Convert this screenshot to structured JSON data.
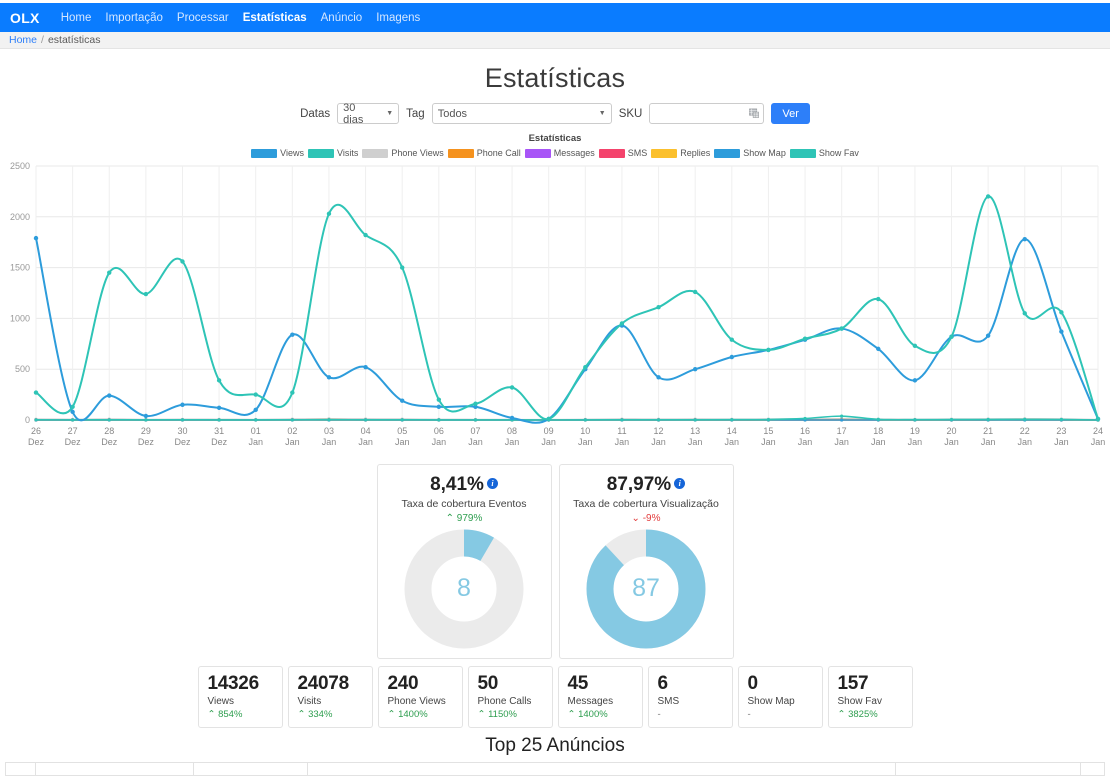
{
  "navbar": {
    "brand": "OLX",
    "items": [
      {
        "label": "Home",
        "active": false
      },
      {
        "label": "Importação",
        "active": false
      },
      {
        "label": "Processar",
        "active": false
      },
      {
        "label": "Estatísticas",
        "active": true
      },
      {
        "label": "Anúncio",
        "active": false
      },
      {
        "label": "Imagens",
        "active": false
      }
    ]
  },
  "breadcrumb": {
    "home": "Home",
    "separator": "/",
    "current": "estatísticas"
  },
  "page": {
    "title": "Estatísticas"
  },
  "filters": {
    "datas_label": "Datas",
    "datas_value": "30 dias",
    "tag_label": "Tag",
    "tag_value": "Todos",
    "sku_label": "SKU",
    "sku_value": "",
    "sku_placeholder": "",
    "submit_label": "Ver"
  },
  "chart_data": {
    "type": "line",
    "title": "Estatísticas",
    "xlabel": "",
    "ylabel": "",
    "ylim": [
      0,
      2500
    ],
    "yticks": [
      0,
      500,
      1000,
      1500,
      2000,
      2500
    ],
    "grid": true,
    "legend_position": "top",
    "x": [
      "26 Dez",
      "27 Dez",
      "28 Dez",
      "29 Dez",
      "30 Dez",
      "31 Dez",
      "01 Jan",
      "02 Jan",
      "03 Jan",
      "04 Jan",
      "05 Jan",
      "06 Jan",
      "07 Jan",
      "08 Jan",
      "09 Jan",
      "10 Jan",
      "11 Jan",
      "12 Jan",
      "13 Jan",
      "14 Jan",
      "15 Jan",
      "16 Jan",
      "17 Jan",
      "18 Jan",
      "19 Jan",
      "20 Jan",
      "21 Jan",
      "22 Jan",
      "23 Jan",
      "24 Jan"
    ],
    "series": [
      {
        "name": "Views",
        "color": "#2d9cdb",
        "values": [
          1790,
          80,
          240,
          40,
          150,
          120,
          100,
          840,
          420,
          520,
          190,
          130,
          130,
          20,
          10,
          500,
          930,
          420,
          500,
          620,
          690,
          790,
          900,
          700,
          390,
          820,
          830,
          1780,
          870,
          10
        ]
      },
      {
        "name": "Visits",
        "color": "#2ec4b6",
        "values": [
          270,
          130,
          1450,
          1240,
          1560,
          390,
          250,
          270,
          2030,
          1820,
          1500,
          200,
          160,
          320,
          10,
          520,
          950,
          1110,
          1260,
          790,
          690,
          800,
          900,
          1190,
          730,
          820,
          2200,
          1050,
          1060,
          10
        ]
      },
      {
        "name": "Phone Views",
        "color": "#cfcfcf",
        "values": [
          8,
          6,
          9,
          5,
          7,
          6,
          5,
          9,
          12,
          10,
          9,
          6,
          5,
          4,
          3,
          6,
          9,
          8,
          9,
          8,
          9,
          10,
          12,
          9,
          7,
          9,
          10,
          12,
          10,
          3
        ]
      },
      {
        "name": "Phone Call",
        "color": "#f5921e",
        "values": [
          2,
          1,
          2,
          1,
          2,
          1,
          1,
          2,
          3,
          2,
          2,
          1,
          1,
          1,
          0,
          1,
          2,
          2,
          2,
          2,
          2,
          2,
          3,
          2,
          2,
          2,
          2,
          3,
          2,
          0
        ]
      },
      {
        "name": "Messages",
        "color": "#a855f7",
        "values": [
          1,
          1,
          2,
          1,
          1,
          1,
          1,
          2,
          2,
          2,
          1,
          1,
          1,
          1,
          0,
          1,
          2,
          1,
          2,
          1,
          2,
          2,
          2,
          2,
          1,
          2,
          2,
          2,
          2,
          0
        ]
      },
      {
        "name": "SMS",
        "color": "#f4436c",
        "values": [
          0,
          0,
          1,
          0,
          0,
          0,
          0,
          1,
          1,
          0,
          0,
          0,
          0,
          0,
          0,
          0,
          1,
          0,
          1,
          0,
          0,
          1,
          1,
          0,
          0,
          0,
          1,
          1,
          0,
          0
        ]
      },
      {
        "name": "Replies",
        "color": "#fbc02d",
        "values": [
          0,
          0,
          0,
          0,
          0,
          0,
          0,
          0,
          1,
          0,
          0,
          0,
          0,
          0,
          0,
          0,
          0,
          0,
          0,
          0,
          0,
          0,
          1,
          0,
          0,
          0,
          0,
          1,
          0,
          0
        ]
      },
      {
        "name": "Show Map",
        "color": "#2d9cdb",
        "values": [
          0,
          0,
          0,
          0,
          0,
          0,
          0,
          0,
          0,
          0,
          0,
          0,
          0,
          0,
          0,
          0,
          0,
          0,
          0,
          0,
          0,
          0,
          0,
          0,
          0,
          0,
          0,
          0,
          0,
          0
        ]
      },
      {
        "name": "Show Fav",
        "color": "#2ec4b6",
        "values": [
          2,
          1,
          2,
          1,
          2,
          1,
          1,
          2,
          3,
          2,
          2,
          1,
          1,
          1,
          0,
          1,
          2,
          2,
          2,
          3,
          4,
          15,
          38,
          6,
          3,
          4,
          5,
          6,
          5,
          0
        ]
      }
    ]
  },
  "gauges": [
    {
      "percent": "8,41%",
      "label": "Taxa de cobertura Eventos",
      "delta": "979%",
      "delta_dir": "up",
      "delta_arrow": "⌃",
      "value": "8",
      "fill": 8.41,
      "fill_color": "#85c9e3",
      "track_color": "#ebebeb"
    },
    {
      "percent": "87,97%",
      "label": "Taxa de cobertura Visualização",
      "delta": "-9%",
      "delta_dir": "down",
      "delta_arrow": "⌄",
      "value": "87",
      "fill": 87.97,
      "fill_color": "#85c9e3",
      "track_color": "#ebebeb"
    }
  ],
  "stats": [
    {
      "value": "14326",
      "label": "Views",
      "delta": "854%",
      "delta_dir": "up"
    },
    {
      "value": "24078",
      "label": "Visits",
      "delta": "334%",
      "delta_dir": "up"
    },
    {
      "value": "240",
      "label": "Phone Views",
      "delta": "1400%",
      "delta_dir": "up"
    },
    {
      "value": "50",
      "label": "Phone Calls",
      "delta": "1150%",
      "delta_dir": "up"
    },
    {
      "value": "45",
      "label": "Messages",
      "delta": "1400%",
      "delta_dir": "up"
    },
    {
      "value": "6",
      "label": "SMS",
      "delta": "-",
      "delta_dir": "none"
    },
    {
      "value": "0",
      "label": "Show Map",
      "delta": "-",
      "delta_dir": "none"
    },
    {
      "value": "157",
      "label": "Show Fav",
      "delta": "3825%",
      "delta_dir": "up"
    }
  ],
  "top_section": {
    "title": "Top 25 Anúncios"
  }
}
